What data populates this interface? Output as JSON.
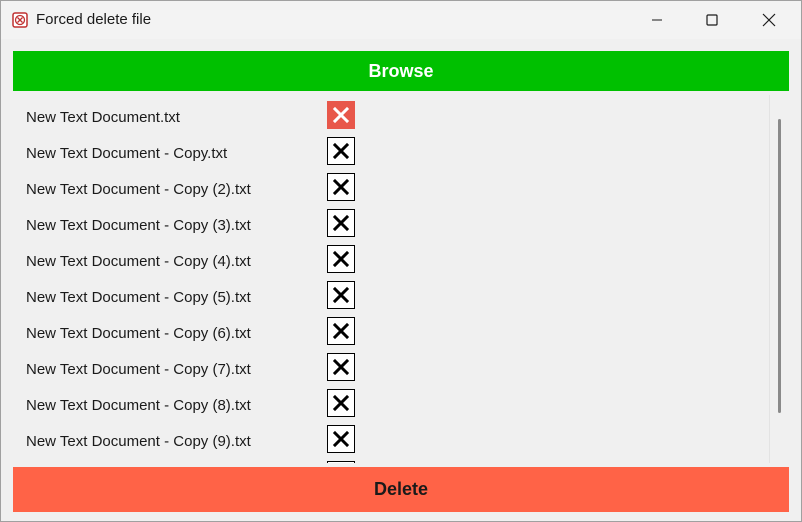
{
  "window": {
    "title": "Forced delete file"
  },
  "browse_label": "Browse",
  "delete_label": "Delete",
  "files": [
    "New Text Document.txt",
    "New Text Document - Copy.txt",
    "New Text Document - Copy (2).txt",
    "New Text Document - Copy (3).txt",
    "New Text Document - Copy (4).txt",
    "New Text Document - Copy (5).txt",
    "New Text Document - Copy (6).txt",
    "New Text Document - Copy (7).txt",
    "New Text Document - Copy (8).txt",
    "New Text Document - Copy (9).txt"
  ],
  "hovered_remove_index": 0,
  "colors": {
    "browse": "#00c000",
    "delete": "#ff6347",
    "remove_hover": "#e8574a"
  },
  "icons": {
    "app": "forced-delete-app-icon",
    "minimize": "minimize-icon",
    "maximize": "maximize-icon",
    "close": "close-icon",
    "remove": "x-icon"
  }
}
